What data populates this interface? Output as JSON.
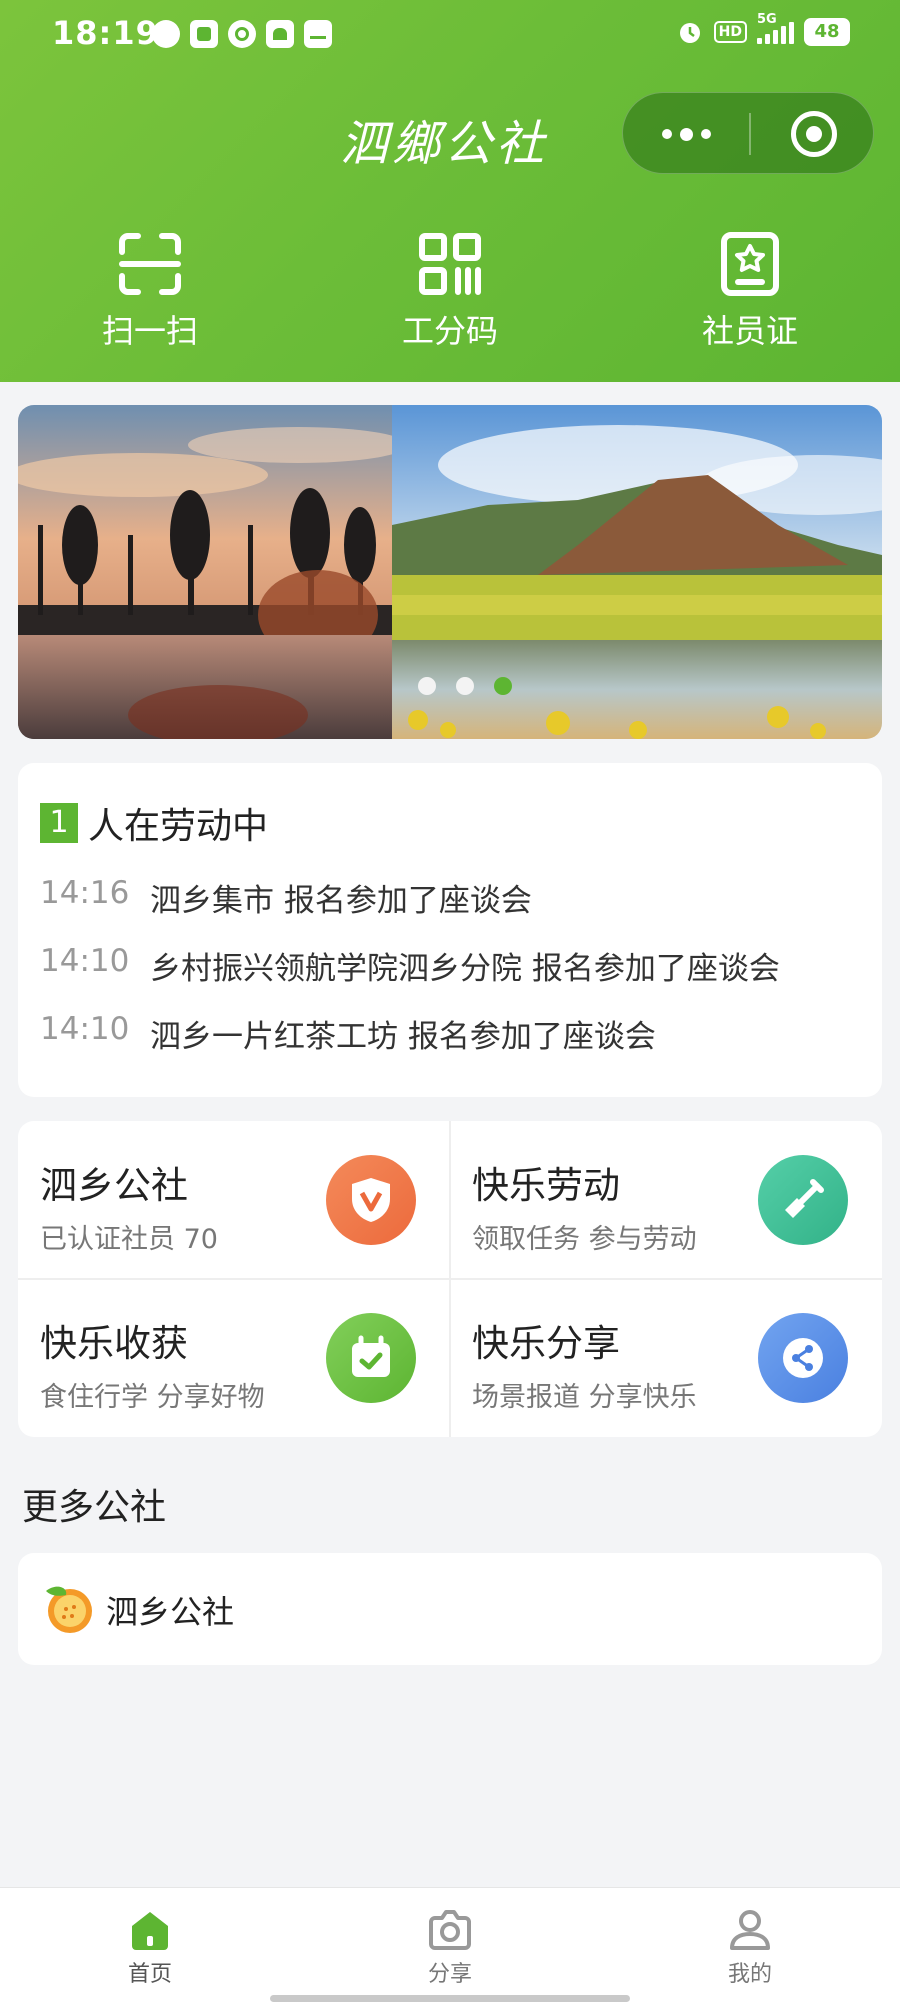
{
  "status_bar": {
    "time": "18:19",
    "hd": "HD",
    "network": "5G",
    "battery": "48"
  },
  "header": {
    "title": "泗鄉公社",
    "quick_actions": [
      {
        "label": "扫一扫",
        "icon": "scan-icon"
      },
      {
        "label": "工分码",
        "icon": "qrcode-icon"
      },
      {
        "label": "社员证",
        "icon": "member-card-icon"
      }
    ]
  },
  "banner": {
    "slides": 3,
    "active_index": 2
  },
  "activity": {
    "badge": "1",
    "title": "人在劳动中",
    "items": [
      {
        "time": "14:16",
        "text": "泗乡集市 报名参加了座谈会"
      },
      {
        "time": "14:10",
        "text": "乡村振兴领航学院泗乡分院 报名参加了座谈会"
      },
      {
        "time": "14:10",
        "text": "泗乡一片红茶工坊 报名参加了座谈会"
      }
    ]
  },
  "features": [
    {
      "title": "泗乡公社",
      "subtitle": "已认证社员 70",
      "icon": "shield-v-icon",
      "color": "#f07a4a"
    },
    {
      "title": "快乐劳动",
      "subtitle": "领取任务 参与劳动",
      "icon": "shovel-icon",
      "color": "#3fbf9a"
    },
    {
      "title": "快乐收获",
      "subtitle": "食住行学 分享好物",
      "icon": "calendar-check-icon",
      "color": "#6cc04a"
    },
    {
      "title": "快乐分享",
      "subtitle": "场景报道 分享快乐",
      "icon": "share-icon",
      "color": "#5a8ee8"
    }
  ],
  "more": {
    "title": "更多公社",
    "items": [
      {
        "name": "泗乡公社",
        "icon": "orange-logo-icon"
      }
    ]
  },
  "tabbar": {
    "items": [
      {
        "label": "首页",
        "icon": "home-icon",
        "active": true
      },
      {
        "label": "分享",
        "icon": "camera-icon",
        "active": false
      },
      {
        "label": "我的",
        "icon": "user-icon",
        "active": false
      }
    ]
  },
  "colors": {
    "brand_green": "#5db532",
    "background": "#f3f4f6"
  }
}
